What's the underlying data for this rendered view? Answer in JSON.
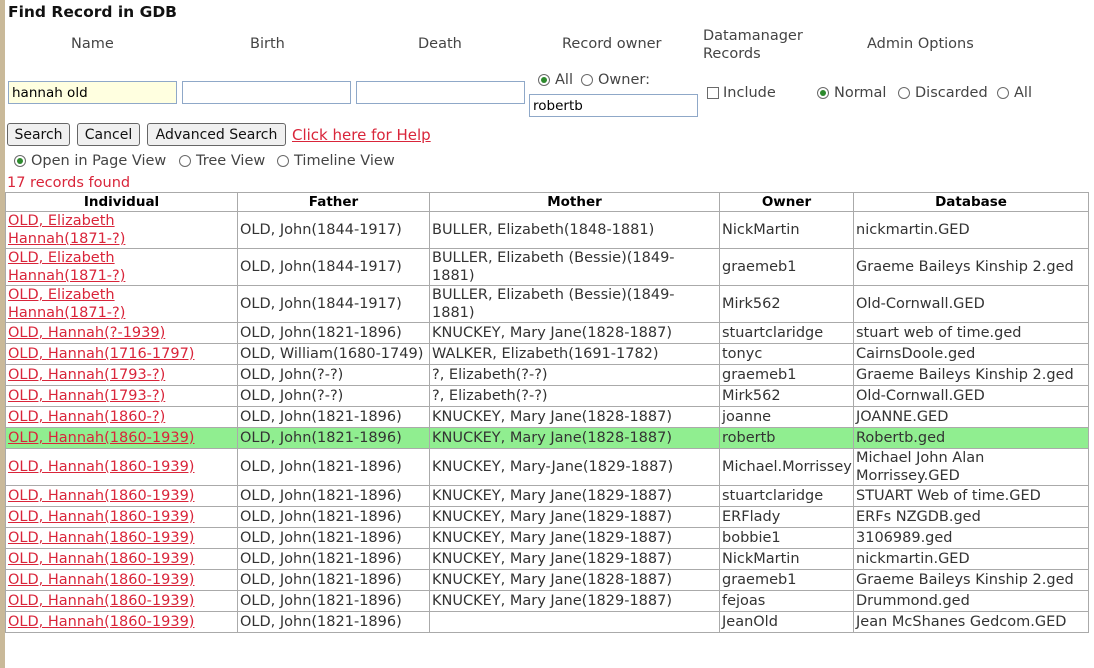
{
  "title": "Find Record in GDB",
  "headers": {
    "name": "Name",
    "birth": "Birth",
    "death": "Death",
    "record_owner": "Record owner",
    "datamanager_line1": "Datamanager",
    "datamanager_line2": "Records",
    "admin_options": "Admin Options"
  },
  "inputs": {
    "name_value": "hannah old",
    "birth_value": "",
    "death_value": "",
    "owner_value": "robertb"
  },
  "owner_options": {
    "all": "All",
    "owner": "Owner:"
  },
  "include_label": "Include",
  "admin_radios": {
    "normal": "Normal",
    "discarded": "Discarded",
    "all": "All"
  },
  "buttons": {
    "search": "Search",
    "cancel": "Cancel",
    "advanced": "Advanced Search"
  },
  "help_link": "Click here for Help",
  "view_options": {
    "page": "Open in Page View",
    "tree": "Tree View",
    "timeline": "Timeline View"
  },
  "records_found": "17 records found",
  "colors": {
    "link": "#d9253a",
    "selected_row": "#90ee90",
    "radio_dot": "#2d8a2d"
  },
  "table": {
    "columns": [
      "Individual",
      "Father",
      "Mother",
      "Owner",
      "Database"
    ],
    "rows": [
      {
        "individual": "OLD, Elizabeth Hannah(1871-?)",
        "father": "OLD, John(1844-1917)",
        "mother": "BULLER, Elizabeth(1848-1881)",
        "owner": "NickMartin",
        "database": "nickmartin.GED"
      },
      {
        "individual": "OLD, Elizabeth Hannah(1871-?)",
        "father": "OLD, John(1844-1917)",
        "mother": "BULLER, Elizabeth (Bessie)(1849-1881)",
        "owner": "graemeb1",
        "database": "Graeme Baileys Kinship 2.ged"
      },
      {
        "individual": "OLD, Elizabeth Hannah(1871-?)",
        "father": "OLD, John(1844-1917)",
        "mother": "BULLER, Elizabeth (Bessie)(1849-1881)",
        "owner": "Mirk562",
        "database": "Old-Cornwall.GED"
      },
      {
        "individual": "OLD, Hannah(?-1939)",
        "father": "OLD, John(1821-1896)",
        "mother": "KNUCKEY, Mary Jane(1828-1887)",
        "owner": "stuartclaridge",
        "database": "stuart web of time.ged"
      },
      {
        "individual": "OLD, Hannah(1716-1797)",
        "father": "OLD, William(1680-1749)",
        "mother": "WALKER, Elizabeth(1691-1782)",
        "owner": "tonyc",
        "database": "CairnsDoole.ged"
      },
      {
        "individual": "OLD, Hannah(1793-?)",
        "father": "OLD, John(?-?)",
        "mother": "?, Elizabeth(?-?)",
        "owner": "graemeb1",
        "database": "Graeme Baileys Kinship 2.ged"
      },
      {
        "individual": "OLD, Hannah(1793-?)",
        "father": "OLD, John(?-?)",
        "mother": "?, Elizabeth(?-?)",
        "owner": "Mirk562",
        "database": "Old-Cornwall.GED"
      },
      {
        "individual": "OLD, Hannah(1860-?)",
        "father": "OLD, John(1821-1896)",
        "mother": "KNUCKEY, Mary Jane(1828-1887)",
        "owner": "joanne",
        "database": "JOANNE.GED"
      },
      {
        "individual": "OLD, Hannah(1860-1939)",
        "father": "OLD, John(1821-1896)",
        "mother": "KNUCKEY, Mary Jane(1828-1887)",
        "owner": "robertb",
        "database": "Robertb.ged",
        "selected": true
      },
      {
        "individual": "OLD, Hannah(1860-1939)",
        "father": "OLD, John(1821-1896)",
        "mother": "KNUCKEY, Mary-Jane(1829-1887)",
        "owner": "Michael.Morrissey",
        "database": "Michael John Alan Morrissey.GED"
      },
      {
        "individual": "OLD, Hannah(1860-1939)",
        "father": "OLD, John(1821-1896)",
        "mother": "KNUCKEY, Mary Jane(1829-1887)",
        "owner": "stuartclaridge",
        "database": "STUART Web of time.GED"
      },
      {
        "individual": "OLD, Hannah(1860-1939)",
        "father": "OLD, John(1821-1896)",
        "mother": "KNUCKEY, Mary Jane(1829-1887)",
        "owner": "ERFlady",
        "database": "ERFs NZGDB.ged"
      },
      {
        "individual": "OLD, Hannah(1860-1939)",
        "father": "OLD, John(1821-1896)",
        "mother": "KNUCKEY, Mary Jane(1829-1887)",
        "owner": "bobbie1",
        "database": "3106989.ged"
      },
      {
        "individual": "OLD, Hannah(1860-1939)",
        "father": "OLD, John(1821-1896)",
        "mother": "KNUCKEY, Mary Jane(1829-1887)",
        "owner": "NickMartin",
        "database": "nickmartin.GED"
      },
      {
        "individual": "OLD, Hannah(1860-1939)",
        "father": "OLD, John(1821-1896)",
        "mother": "KNUCKEY, Mary Jane(1828-1887)",
        "owner": "graemeb1",
        "database": "Graeme Baileys Kinship 2.ged"
      },
      {
        "individual": "OLD, Hannah(1860-1939)",
        "father": "OLD, John(1821-1896)",
        "mother": "KNUCKEY, Mary Jane(1829-1887)",
        "owner": "fejoas",
        "database": "Drummond.ged"
      },
      {
        "individual": "OLD, Hannah(1860-1939)",
        "father": "OLD, John(1821-1896)",
        "mother": "",
        "owner": "JeanOld",
        "database": "Jean McShanes Gedcom.GED"
      }
    ]
  }
}
